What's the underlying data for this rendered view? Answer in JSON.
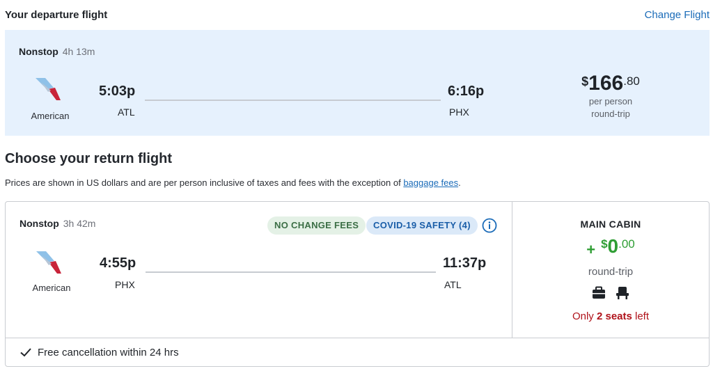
{
  "departure": {
    "header": "Your departure flight",
    "change_link": "Change Flight",
    "stops": "Nonstop",
    "duration": "4h 13m",
    "airline": "American",
    "depart_time": "5:03p",
    "depart_code": "ATL",
    "arrive_time": "6:16p",
    "arrive_code": "PHX",
    "price": {
      "currency": "$",
      "whole": "166",
      "cents": ".80",
      "line1": "per person",
      "line2": "round-trip"
    }
  },
  "return_section": {
    "title": "Choose your return flight",
    "disclaimer_prefix": "Prices are shown in US dollars and are per person inclusive of taxes and fees with the exception of ",
    "disclaimer_link": "baggage fees",
    "disclaimer_suffix": "."
  },
  "return_flight": {
    "stops": "Nonstop",
    "duration": "3h 42m",
    "badges": {
      "no_change_fees": "NO CHANGE FEES",
      "covid_safety": "COVID-19 SAFETY (4)"
    },
    "airline": "American",
    "depart_time": "4:55p",
    "depart_code": "PHX",
    "arrive_time": "11:37p",
    "arrive_code": "ATL",
    "cabin": {
      "name": "MAIN CABIN",
      "plus": "+",
      "currency": "$",
      "whole": "0",
      "cents": ".00",
      "trip": "round-trip",
      "seats_prefix": "Only ",
      "seats_bold": "2 seats",
      "seats_suffix": " left"
    },
    "free_cancellation": "Free cancellation within 24 hrs"
  },
  "colors": {
    "link": "#1a6bb8",
    "card_bg": "#e6f1fd",
    "price_green": "#2f9e34",
    "seats_red": "#b0131b"
  },
  "icons": [
    "american-airlines-logo",
    "info-icon",
    "briefcase-icon",
    "seat-icon",
    "check-icon"
  ]
}
